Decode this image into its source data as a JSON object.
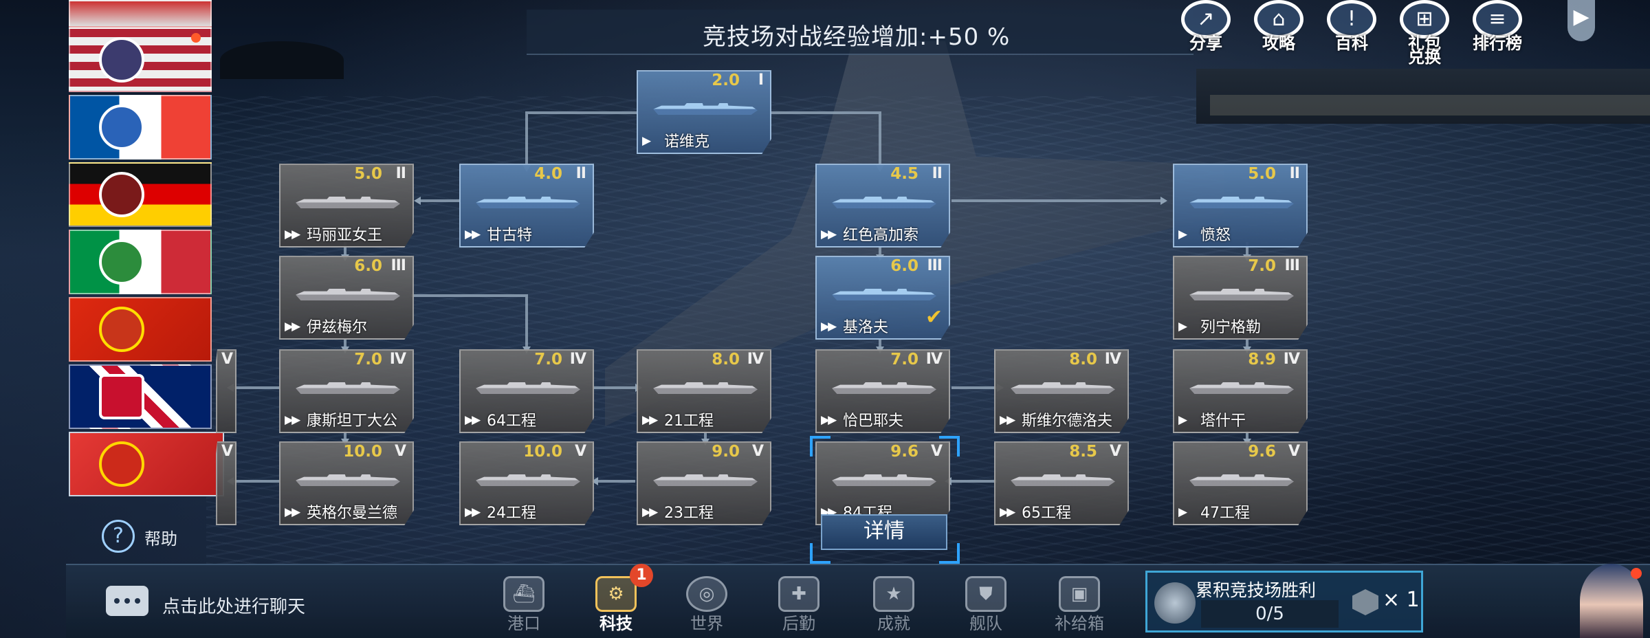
{
  "banner": {
    "text": "竞技场对战经验增加:+50 %"
  },
  "top_icons": [
    {
      "label": "分享",
      "icon": "share-icon"
    },
    {
      "label": "攻略",
      "icon": "home-icon"
    },
    {
      "label": "百科",
      "icon": "encyclopedia-icon"
    },
    {
      "label": "礼包\n兑换",
      "label_line1": "礼包",
      "label_line2": "兑换",
      "icon": "gift-icon"
    },
    {
      "label": "排行榜",
      "icon": "ranking-icon"
    }
  ],
  "nations": [
    {
      "name": "usa",
      "colors": [
        "#b22234",
        "#ffffff",
        "#3c3b6e"
      ]
    },
    {
      "name": "france",
      "colors": [
        "#0055a4",
        "#ffffff",
        "#ef4135"
      ]
    },
    {
      "name": "germany",
      "colors": [
        "#000000",
        "#dd0000",
        "#ffce00"
      ]
    },
    {
      "name": "italy",
      "colors": [
        "#009246",
        "#ffffff",
        "#ce2b37"
      ]
    },
    {
      "name": "china",
      "colors": [
        "#de2910",
        "#ffde00"
      ]
    },
    {
      "name": "uk",
      "colors": [
        "#012169",
        "#ffffff",
        "#c8102e"
      ]
    },
    {
      "name": "ussr",
      "colors": [
        "#cc0000",
        "#ffd700"
      ],
      "selected": true
    }
  ],
  "tree_nodes": [
    {
      "name": "诺维克",
      "level": "2.0",
      "tier": "I",
      "type": "destroyer",
      "owned": true
    },
    {
      "name": "甘古特",
      "level": "4.0",
      "tier": "II",
      "type": "battleship",
      "owned": true
    },
    {
      "name": "玛丽亚女王",
      "level": "5.0",
      "tier": "II",
      "type": "battleship",
      "owned": false
    },
    {
      "name": "红色高加索",
      "level": "4.5",
      "tier": "II",
      "type": "cruiser",
      "owned": true
    },
    {
      "name": "愤怒",
      "level": "5.0",
      "tier": "II",
      "type": "destroyer",
      "owned": true
    },
    {
      "name": "伊兹梅尔",
      "level": "6.0",
      "tier": "III",
      "type": "battleship",
      "owned": false
    },
    {
      "name": "基洛夫",
      "level": "6.0",
      "tier": "III",
      "type": "cruiser",
      "owned": true,
      "checked": true
    },
    {
      "name": "列宁格勒",
      "level": "7.0",
      "tier": "III",
      "type": "destroyer",
      "owned": false
    },
    {
      "name": "康斯坦丁大公",
      "level": "7.0",
      "tier": "IV",
      "type": "battleship",
      "owned": false
    },
    {
      "name": "64工程",
      "level": "7.0",
      "tier": "IV",
      "type": "battleship",
      "owned": false
    },
    {
      "name": "21工程",
      "level": "8.0",
      "tier": "IV",
      "type": "battleship",
      "owned": false
    },
    {
      "name": "恰巴耶夫",
      "level": "7.0",
      "tier": "IV",
      "type": "cruiser",
      "owned": false
    },
    {
      "name": "斯维尔德洛夫",
      "level": "8.0",
      "tier": "IV",
      "type": "cruiser",
      "owned": false
    },
    {
      "name": "塔什干",
      "level": "8.9",
      "tier": "IV",
      "type": "destroyer",
      "owned": false
    },
    {
      "name": "英格尔曼兰德",
      "level": "10.0",
      "tier": "V",
      "type": "battleship",
      "owned": false
    },
    {
      "name": "24工程",
      "level": "10.0",
      "tier": "V",
      "type": "battleship",
      "owned": false
    },
    {
      "name": "23工程",
      "level": "9.0",
      "tier": "V",
      "type": "battleship",
      "owned": false
    },
    {
      "name": "84工程",
      "level": "9.6",
      "tier": "V",
      "type": "cruiser",
      "owned": false,
      "selected": true
    },
    {
      "name": "65工程",
      "level": "8.5",
      "tier": "V",
      "type": "cruiser",
      "owned": false
    },
    {
      "name": "47工程",
      "level": "9.6",
      "tier": "V",
      "type": "destroyer",
      "owned": false
    }
  ],
  "partial_nodes": [
    {
      "tier": "V",
      "row": "iv"
    },
    {
      "tier": "V",
      "row": "v"
    }
  ],
  "type_marks": {
    "battleship": "▶▶",
    "cruiser": "▶▶",
    "destroyer": "▶"
  },
  "detail_button": {
    "label": "详情"
  },
  "help": {
    "label": "帮助",
    "icon": "?"
  },
  "chat": {
    "placeholder": "点击此处进行聊天"
  },
  "bottom_nav": [
    {
      "label": "港口",
      "icon": "harbor-icon",
      "active": false
    },
    {
      "label": "科技",
      "icon": "tech-icon",
      "active": true,
      "badge": "1"
    },
    {
      "label": "世界",
      "icon": "world-icon",
      "active": false
    },
    {
      "label": "后勤",
      "icon": "logistics-icon",
      "active": false
    },
    {
      "label": "成就",
      "icon": "achievement-icon",
      "active": false
    },
    {
      "label": "舰队",
      "icon": "fleet-icon",
      "active": false
    },
    {
      "label": "补给箱",
      "icon": "supply-box-icon",
      "active": false
    }
  ],
  "reward": {
    "title": "累积竞技场胜利",
    "progress_text": "0/5",
    "progress_value": 0,
    "progress_max": 5,
    "multiplier": "× 1"
  },
  "colors": {
    "accent": "#2ea3ff",
    "gold": "#e7c84a",
    "badge": "#e3472a"
  }
}
